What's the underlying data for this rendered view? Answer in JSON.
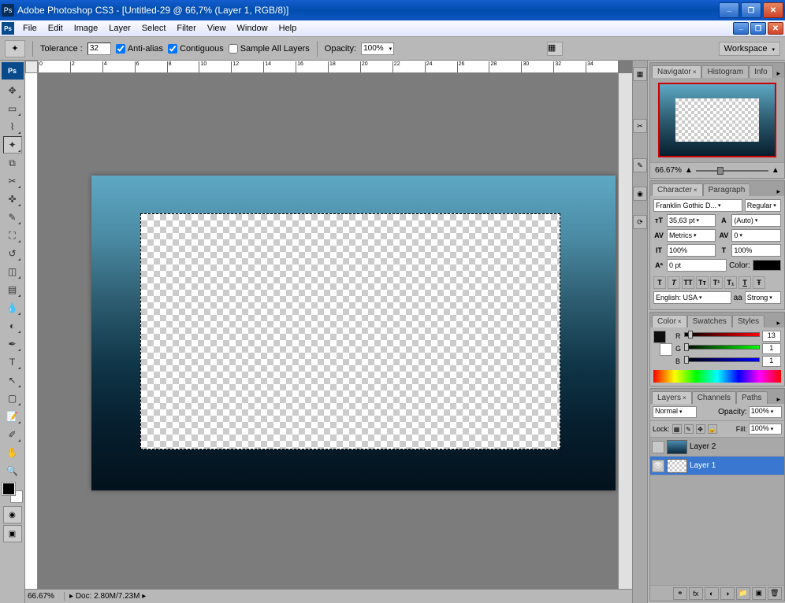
{
  "title": "Adobe Photoshop CS3 - [Untitled-29 @ 66,7% (Layer 1, RGB/8)]",
  "menu": [
    "File",
    "Edit",
    "Image",
    "Layer",
    "Select",
    "Filter",
    "View",
    "Window",
    "Help"
  ],
  "options": {
    "tolerance_label": "Tolerance :",
    "tolerance": "32",
    "antialias": "Anti-alias",
    "contiguous": "Contiguous",
    "sample_all": "Sample All Layers",
    "opacity_label": "Opacity:",
    "opacity": "100%",
    "workspace": "Workspace"
  },
  "status": {
    "zoom": "66.67%",
    "doc": "Doc: 2.80M/7.23M"
  },
  "navigator": {
    "tabs": [
      "Navigator",
      "Histogram",
      "Info"
    ],
    "zoom": "66.67%"
  },
  "character": {
    "tabs": [
      "Character",
      "Paragraph"
    ],
    "font": "Franklin Gothic D...",
    "style": "Regular",
    "size": "35,63 pt",
    "leading": "(Auto)",
    "kerning": "Metrics",
    "tracking": "0",
    "vscale": "100%",
    "hscale": "100%",
    "baseline": "0 pt",
    "color_label": "Color:",
    "lang": "English: USA",
    "aa_label": "aa",
    "aa": "Strong"
  },
  "color": {
    "tabs": [
      "Color",
      "Swatches",
      "Styles"
    ],
    "r": "13",
    "g": "1",
    "b": "1"
  },
  "layers": {
    "tabs": [
      "Layers",
      "Channels",
      "Paths"
    ],
    "blend": "Normal",
    "opacity_label": "Opacity:",
    "opacity": "100%",
    "lock_label": "Lock:",
    "fill_label": "Fill:",
    "fill": "100%",
    "items": [
      {
        "name": "Layer 2",
        "visible": false
      },
      {
        "name": "Layer 1",
        "visible": true
      }
    ]
  }
}
